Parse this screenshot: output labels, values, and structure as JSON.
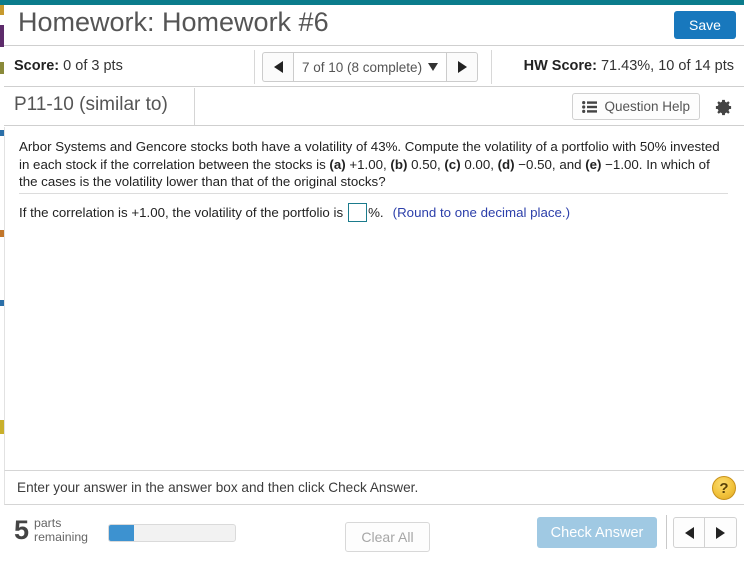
{
  "window": {
    "accent_color": "#0b7c8c"
  },
  "header": {
    "title": "Homework: Homework #6",
    "save_label": "Save",
    "save_color": "#1878bd"
  },
  "score_bar": {
    "score_label": "Score:",
    "score_value": "0 of 3 pts",
    "nav_prev_icon": "triangle-left-icon",
    "nav_next_icon": "triangle-right-icon",
    "question_selector": "7 of 10 (8 complete)",
    "selector_caret_icon": "caret-down-icon",
    "hw_score_label": "HW Score:",
    "hw_score_value": "71.43%, 10 of 14 pts"
  },
  "exercise_header": {
    "exercise_id": "P11-10 (similar to)",
    "question_help_label": "Question Help",
    "question_help_icon": "list-icon",
    "settings_icon": "gear-icon"
  },
  "question": {
    "body_part_1": "Arbor Systems and Gencore stocks both have a volatility of 43%. Compute the volatility of a portfolio with 50% invested in each stock if the correlation between the stocks is ",
    "choice_a": "(a)",
    "choice_a_value": " +1.00, ",
    "choice_b": "(b)",
    "choice_b_value": " 0.50, ",
    "choice_c": "(c)",
    "choice_c_value": " 0.00, ",
    "choice_d": "(d)",
    "choice_d_value": " −0.50, and ",
    "choice_e": "(e)",
    "choice_e_value": " −1.00. ",
    "body_part_2": "In which of the cases is the volatility lower than that of the original stocks?"
  },
  "answer": {
    "prompt": "If the correlation is +1.00, the volatility of the portfolio is",
    "input_value": "",
    "input_placeholder": "",
    "unit_suffix": "%.",
    "rounding_hint": "(Round to one decimal place.)",
    "hint_color": "#2c3faa",
    "input_border_color": "#1b7b8c"
  },
  "instruction": {
    "text": "Enter your answer in the answer box and then click Check Answer.",
    "help_badge_glyph": "?"
  },
  "footer": {
    "parts_remaining_count": "5",
    "parts_remaining_label_line1": "parts",
    "parts_remaining_label_line2": "remaining",
    "progress_percent": 20,
    "progress_fill_color": "#3d92d0",
    "clear_all_label": "Clear All",
    "check_answer_label": "Check Answer",
    "check_answer_color": "#a0c9e3",
    "prev_icon": "triangle-left-icon",
    "next_icon": "triangle-right-icon"
  }
}
